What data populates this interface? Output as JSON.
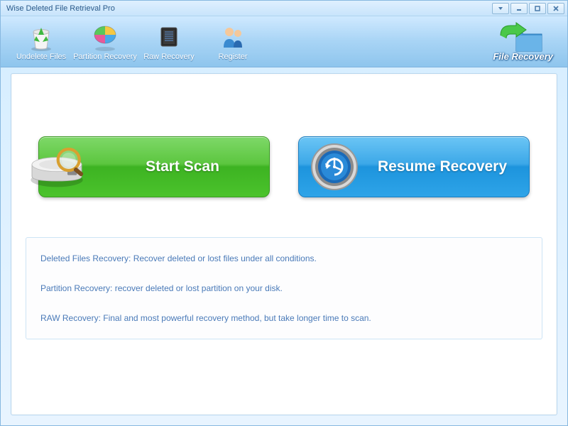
{
  "window": {
    "title": "Wise Deleted File Retrieval Pro"
  },
  "toolbar": {
    "items": [
      {
        "label": "Undelete Files"
      },
      {
        "label": "Partition Recovery"
      },
      {
        "label": "Raw Recovery"
      },
      {
        "label": "Register"
      }
    ],
    "brand": "File Recovery"
  },
  "main": {
    "start_scan": "Start  Scan",
    "resume_recovery": "Resume Recovery"
  },
  "info": {
    "line1": "Deleted Files Recovery: Recover deleted or lost files  under all conditions.",
    "line2": "Partition Recovery: recover deleted or lost partition on your disk.",
    "line3": "RAW Recovery: Final and most powerful recovery method, but take longer time to scan."
  }
}
